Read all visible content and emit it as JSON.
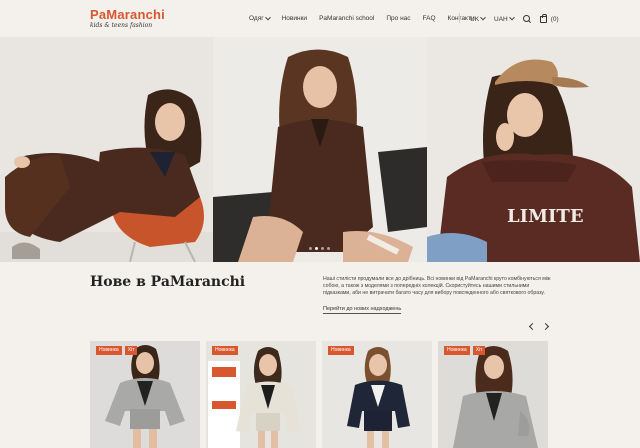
{
  "header": {
    "logo": "PaMaranchi",
    "logo_tagline": "kids & teens fashion",
    "nav": [
      {
        "label": "Одяг",
        "has_dropdown": true
      },
      {
        "label": "Новинки",
        "has_dropdown": false
      },
      {
        "label": "PaMaranchi school",
        "has_dropdown": false
      },
      {
        "label": "Про нас",
        "has_dropdown": false
      },
      {
        "label": "FAQ",
        "has_dropdown": false
      },
      {
        "label": "Контакти",
        "has_dropdown": false
      }
    ],
    "language": "UK",
    "currency": "UAH",
    "cart_count": "(0)"
  },
  "hero": {
    "slides_total": 4,
    "active_slide": 2,
    "slide3_sweatshirt_text": "LIMITE"
  },
  "new_section": {
    "title": "Нове в PaMaranchi",
    "description": "Наші стилісти продумали все до дрібниць. Всі новинки від PaMaranchi круто комбінуються між собою, а також з моделями з попередніх колекцій. Скористуйтесь нашими стильними підказками, аби не витрачати багато часу для вибору повсякденного або святкового образу.",
    "link": "Перейти до нових надходжень"
  },
  "products": [
    {
      "badges": [
        "Новинка",
        "Хіт"
      ]
    },
    {
      "badges": [
        "Новинка"
      ]
    },
    {
      "badges": [
        "Новинка"
      ]
    },
    {
      "badges": [
        "Новинка",
        "Хіт"
      ]
    }
  ],
  "colors": {
    "brand": "#d9572f",
    "background": "#f4f1ec"
  }
}
